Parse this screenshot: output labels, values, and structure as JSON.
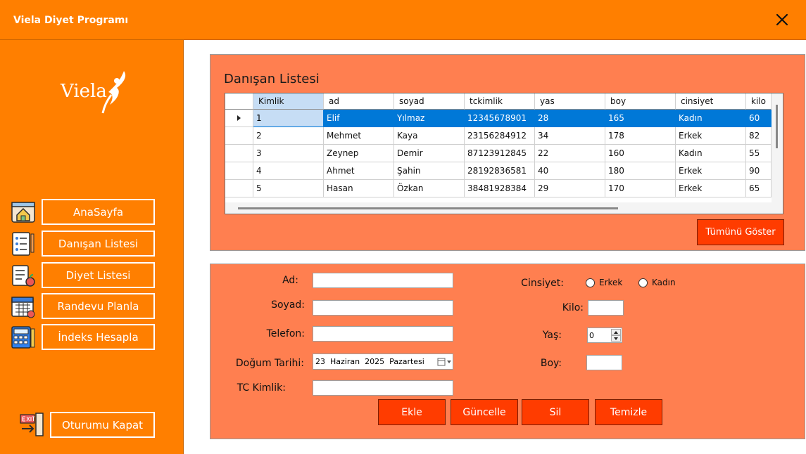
{
  "app": {
    "title": "Viela Diyet Programı"
  },
  "icons": {
    "close": "close-icon"
  },
  "sidebar": {
    "logo_text": "Viela",
    "nav": [
      {
        "label": "AnaSayfa",
        "icon": "home-icon"
      },
      {
        "label": "Danışan Listesi",
        "icon": "checklist-icon"
      },
      {
        "label": "Diyet Listesi",
        "icon": "diet-list-icon"
      },
      {
        "label": "Randevu Planla",
        "icon": "calendar-icon"
      },
      {
        "label": "İndeks Hesapla",
        "icon": "calculator-icon"
      }
    ],
    "logout_label": "Oturumu Kapat",
    "logout_icon": "exit-icon"
  },
  "client_list": {
    "title": "Danışan Listesi",
    "columns": [
      "Kimlik",
      "ad",
      "soyad",
      "tckimlik",
      "yas",
      "boy",
      "cinsiyet",
      "kilo"
    ],
    "rows": [
      [
        "1",
        "Elif",
        "Yılmaz",
        "12345678901",
        "28",
        "165",
        "Kadın",
        "60"
      ],
      [
        "2",
        "Mehmet",
        "Kaya",
        "23156284912",
        "34",
        "178",
        "Erkek",
        "82"
      ],
      [
        "3",
        "Zeynep",
        "Demir",
        "87123912845",
        "22",
        "160",
        "Kadın",
        "55"
      ],
      [
        "4",
        "Ahmet",
        "Şahin",
        "28192836581",
        "40",
        "180",
        "Erkek",
        "90"
      ],
      [
        "5",
        "Hasan",
        "Özkan",
        "38481928384",
        "29",
        "170",
        "Erkek",
        "65"
      ]
    ],
    "show_all_label": "Tümünü Göster"
  },
  "form": {
    "ad_label": "Ad:",
    "ad_value": "",
    "soyad_label": "Soyad:",
    "soyad_value": "",
    "telefon_label": "Telefon:",
    "telefon_value": "",
    "dogum_label": "Doğum Tarihi:",
    "dogum_day": "23",
    "dogum_month": "Haziran",
    "dogum_year": "2025",
    "dogum_weekday": "Pazartesi",
    "tc_label": "TC Kimlik:",
    "tc_value": "",
    "cinsiyet_label": "Cinsiyet:",
    "radio_erkek": "Erkek",
    "radio_kadin": "Kadın",
    "kilo_label": "Kilo:",
    "kilo_value": "",
    "yas_label": "Yaş:",
    "yas_value": "0",
    "boy_label": "Boy:",
    "boy_value": ""
  },
  "actions": {
    "add": "Ekle",
    "update": "Güncelle",
    "delete": "Sil",
    "clear": "Temizle"
  },
  "colors": {
    "accent": "#ff7f00",
    "panel": "#ff7f50",
    "button": "#ff3c00",
    "selection": "#0078d7",
    "header_highlight": "#c6ddf5"
  }
}
